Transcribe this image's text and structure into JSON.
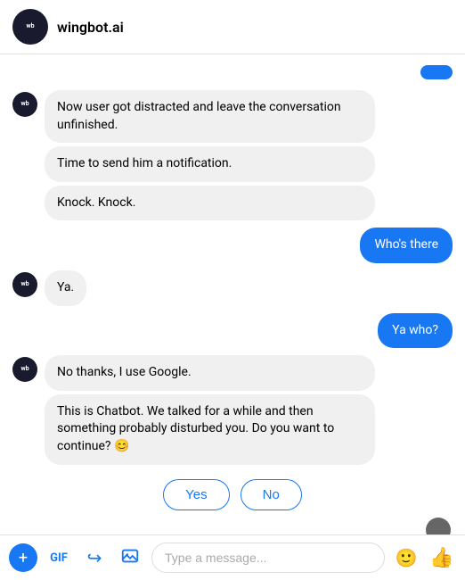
{
  "header": {
    "avatar_label": "wb",
    "title": "wingbot.ai"
  },
  "messages": [
    {
      "type": "user_partial",
      "text": ""
    },
    {
      "type": "bot_group_1",
      "bubbles": [
        "Now user got distracted and leave the conversation unfinished.",
        "Time to send him a notification.",
        "Knock. Knock."
      ]
    },
    {
      "type": "user",
      "text": "Who's there"
    },
    {
      "type": "bot_group_2",
      "bubbles": [
        "Ya."
      ]
    },
    {
      "type": "user",
      "text": "Ya who?"
    },
    {
      "type": "bot_group_3",
      "bubbles": [
        "No thanks, I use Google.",
        "This is Chatbot. We talked for a while and then something probably disturbed you. Do you want to continue? 😊"
      ]
    }
  ],
  "action_buttons": {
    "yes_label": "Yes",
    "no_label": "No"
  },
  "typing": {
    "visible": true
  },
  "input_bar": {
    "placeholder": "Type a message...",
    "value": ""
  },
  "icons": {
    "plus": "+",
    "gif": "GIF",
    "forward": "↪",
    "image": "🖼",
    "emoji": "🙂",
    "thumbs_up": "👍"
  }
}
